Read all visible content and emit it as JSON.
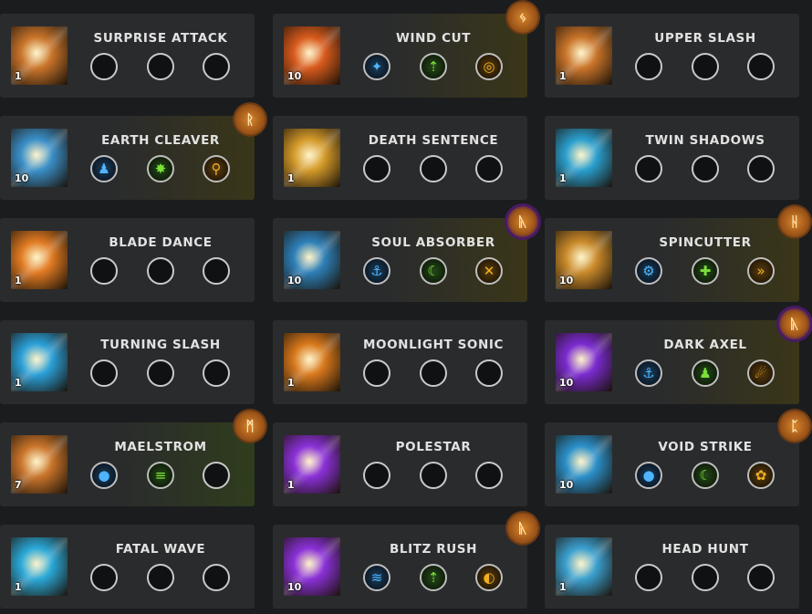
{
  "skills": [
    {
      "name": "SURPRISE ATTACK",
      "level": "1",
      "icon": "surprise-attack-icon",
      "color": "#c9742a",
      "runeColor": "",
      "runeGlyph": "",
      "tint": "",
      "tripods": []
    },
    {
      "name": "WIND CUT",
      "level": "10",
      "icon": "wind-cut-icon",
      "color": "#d85a1c",
      "runeColor": "orange",
      "runeGlyph": "ᛃ",
      "tint": "gold",
      "tripods": [
        {
          "color": "blue",
          "glyph": "✦"
        },
        {
          "color": "green",
          "glyph": "⇡"
        },
        {
          "color": "gold",
          "glyph": "◎"
        }
      ]
    },
    {
      "name": "UPPER SLASH",
      "level": "1",
      "icon": "upper-slash-icon",
      "color": "#c9742a",
      "runeColor": "",
      "runeGlyph": "",
      "tint": "",
      "tripods": []
    },
    {
      "name": "EARTH CLEAVER",
      "level": "10",
      "icon": "earth-cleaver-icon",
      "color": "#3a8fc9",
      "runeColor": "orange",
      "runeGlyph": "ᚱ",
      "tint": "gold",
      "tripods": [
        {
          "color": "blue",
          "glyph": "♟"
        },
        {
          "color": "green",
          "glyph": "✸"
        },
        {
          "color": "gold",
          "glyph": "⚲"
        }
      ]
    },
    {
      "name": "DEATH SENTENCE",
      "level": "1",
      "icon": "death-sentence-icon",
      "color": "#d49a2a",
      "runeColor": "",
      "runeGlyph": "",
      "tint": "",
      "tripods": []
    },
    {
      "name": "TWIN SHADOWS",
      "level": "1",
      "icon": "twin-shadows-icon",
      "color": "#2a9fcf",
      "runeColor": "",
      "runeGlyph": "",
      "tint": "",
      "tripods": []
    },
    {
      "name": "BLADE DANCE",
      "level": "1",
      "icon": "blade-dance-icon",
      "color": "#e07a22",
      "runeColor": "",
      "runeGlyph": "",
      "tint": "",
      "tripods": []
    },
    {
      "name": "SOUL ABSORBER",
      "level": "10",
      "icon": "soul-absorber-icon",
      "color": "#2d7fb8",
      "runeColor": "purple",
      "runeGlyph": "ᚣ",
      "tint": "gold",
      "tripods": [
        {
          "color": "blue",
          "glyph": "⚓"
        },
        {
          "color": "green",
          "glyph": "☾"
        },
        {
          "color": "gold",
          "glyph": "✕"
        }
      ]
    },
    {
      "name": "SPINCUTTER",
      "level": "10",
      "icon": "spincutter-icon",
      "color": "#c98a2a",
      "runeColor": "orange",
      "runeGlyph": "ᚺ",
      "tint": "gold",
      "tripods": [
        {
          "color": "blue",
          "glyph": "⚙"
        },
        {
          "color": "green",
          "glyph": "✚"
        },
        {
          "color": "gold",
          "glyph": "»"
        }
      ]
    },
    {
      "name": "TURNING SLASH",
      "level": "1",
      "icon": "turning-slash-icon",
      "color": "#2a9fd8",
      "runeColor": "",
      "runeGlyph": "",
      "tint": "",
      "tripods": []
    },
    {
      "name": "MOONLIGHT SONIC",
      "level": "1",
      "icon": "moonlight-sonic-icon",
      "color": "#d8781c",
      "runeColor": "",
      "runeGlyph": "",
      "tint": "",
      "tripods": []
    },
    {
      "name": "DARK AXEL",
      "level": "10",
      "icon": "dark-axel-icon",
      "color": "#7a2ad0",
      "runeColor": "purple",
      "runeGlyph": "ᚣ",
      "tint": "gold",
      "tripods": [
        {
          "color": "blue",
          "glyph": "⚓"
        },
        {
          "color": "green",
          "glyph": "♟"
        },
        {
          "color": "gold",
          "glyph": "☄"
        }
      ]
    },
    {
      "name": "MAELSTROM",
      "level": "7",
      "icon": "maelstrom-icon",
      "color": "#c9742a",
      "runeColor": "orange",
      "runeGlyph": "ᛗ",
      "tint": "green",
      "tripods": [
        {
          "color": "blue",
          "glyph": "●"
        },
        {
          "color": "green",
          "glyph": "≡"
        }
      ]
    },
    {
      "name": "POLESTAR",
      "level": "1",
      "icon": "polestar-icon",
      "color": "#8a30d8",
      "runeColor": "",
      "runeGlyph": "",
      "tint": "",
      "tripods": []
    },
    {
      "name": "VOID STRIKE",
      "level": "10",
      "icon": "void-strike-icon",
      "color": "#2a8fc9",
      "runeColor": "orange",
      "runeGlyph": "ᛈ",
      "tint": "",
      "tripods": [
        {
          "color": "blue",
          "glyph": "●"
        },
        {
          "color": "green",
          "glyph": "☾"
        },
        {
          "color": "gold",
          "glyph": "✿"
        }
      ]
    },
    {
      "name": "FATAL WAVE",
      "level": "1",
      "icon": "fatal-wave-icon",
      "color": "#2aa8d8",
      "runeColor": "",
      "runeGlyph": "",
      "tint": "",
      "tripods": []
    },
    {
      "name": "BLITZ RUSH",
      "level": "10",
      "icon": "blitz-rush-icon",
      "color": "#8a30d8",
      "runeColor": "orange",
      "runeGlyph": "ᚣ",
      "tint": "",
      "tripods": [
        {
          "color": "blue",
          "glyph": "≋"
        },
        {
          "color": "green",
          "glyph": "⇡"
        },
        {
          "color": "gold",
          "glyph": "◐"
        }
      ]
    },
    {
      "name": "HEAD HUNT",
      "level": "1",
      "icon": "head-hunt-icon",
      "color": "#3a9fcf",
      "runeColor": "",
      "runeGlyph": "",
      "tint": "",
      "tripods": []
    }
  ]
}
